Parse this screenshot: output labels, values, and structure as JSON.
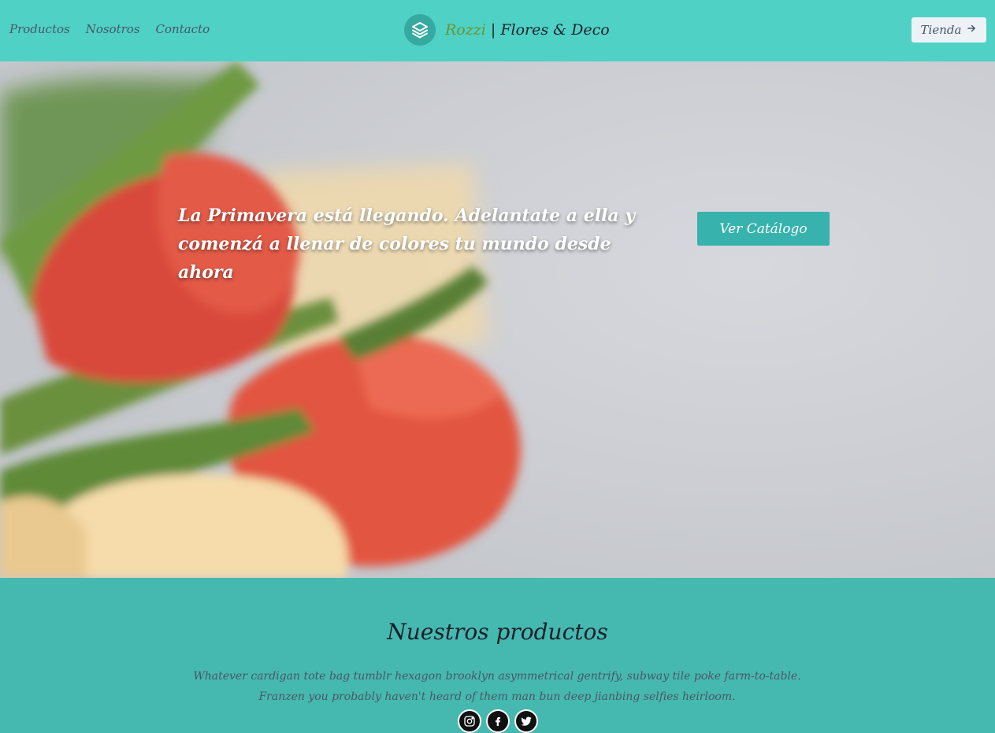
{
  "nav": {
    "items": [
      {
        "label": "Productos"
      },
      {
        "label": "Nosotros"
      },
      {
        "label": "Contacto"
      }
    ]
  },
  "brand": {
    "name": "Rozzi",
    "tagline": "| Flores & Deco",
    "icon": "layers-icon"
  },
  "header": {
    "shop_label": "Tienda",
    "shop_icon": "arrow-right-icon"
  },
  "hero": {
    "headline": "La Primavera está llegando. Adelantate a ella y comenzá a llenar de colores tu mundo desde ahora",
    "cta_label": "Ver Catálogo"
  },
  "products": {
    "title": "Nuestros productos",
    "description": "Whatever cardigan tote bag tumblr hexagon brooklyn asymmetrical gentrify, subway tile poke farm-to-table. Franzen you probably haven't heard of them man bun deep jianbing selfies heirloom.",
    "socials": [
      {
        "icon": "instagram-icon"
      },
      {
        "icon": "facebook-icon"
      },
      {
        "icon": "twitter-icon"
      }
    ]
  },
  "colors": {
    "header_bg": "#4fd1c5",
    "accent": "#38b2ac",
    "brand_name": "#68972f",
    "section_bg": "#45b9b0"
  }
}
